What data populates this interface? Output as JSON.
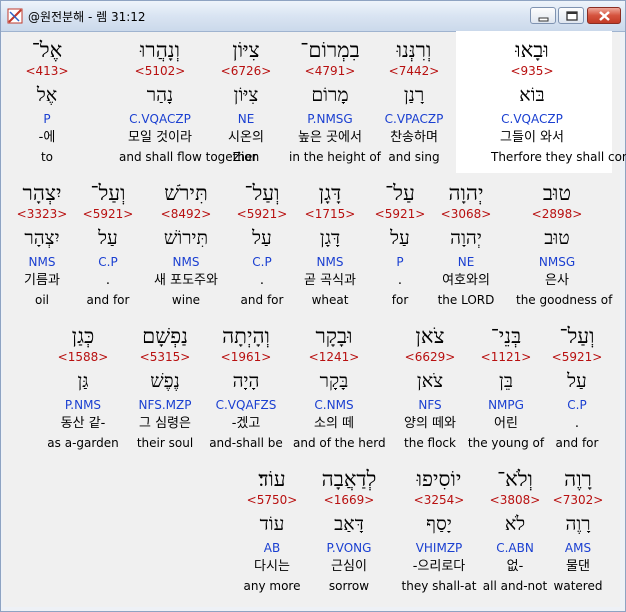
{
  "window": {
    "title": "@원전분해 - 렘 31:12"
  },
  "rows": [
    [
      {
        "heb": "וּבָאוּ",
        "strong": "<935>",
        "root": "בּוֹא",
        "morph": "C.VQACZP",
        "kor": "그들이 와서",
        "eng": "Therfore they shall come",
        "selected": true
      },
      {
        "heb": "וְרִנְּנוּ",
        "strong": "<7442>",
        "root": "רָנַן",
        "morph": "C.VPACZP",
        "kor": "찬송하며",
        "eng": "and sing"
      },
      {
        "heb": "בִמְרוֹם־",
        "strong": "<4791>",
        "root": "מָרוֹם",
        "morph": "P.NMSG",
        "kor": "높은 곳에서",
        "eng": "in the height of"
      },
      {
        "heb": "צִיּוֹן",
        "strong": "<6726>",
        "root": "צִיּוֹן",
        "morph": "NE",
        "kor": "시온의",
        "eng": "Zion"
      },
      {
        "heb": "וְנָהֲרוּ",
        "strong": "<5102>",
        "root": "נָהַר",
        "morph": "C.VQACZP",
        "kor": "모일 것이라",
        "eng": "and shall flow together"
      },
      {
        "heb": "אֶל־",
        "strong": "<413>",
        "root": "אֶל",
        "morph": "P",
        "kor": "-에",
        "eng": "to"
      }
    ],
    [
      {
        "heb": "טוּב",
        "strong": "<2898>",
        "root": "טוּב",
        "morph": "NMSG",
        "kor": "은사",
        "eng": "the goodness of"
      },
      {
        "heb": "יְהוָה",
        "strong": "<3068>",
        "root": "יְהוָה",
        "morph": "NE",
        "kor": "여호와의",
        "eng": "the LORD"
      },
      {
        "heb": "עַל־",
        "strong": "<5921>",
        "root": "עַל",
        "morph": "P",
        "kor": ".",
        "eng": "for"
      },
      {
        "heb": "דָּגָן",
        "strong": "<1715>",
        "root": "דָּגָן",
        "morph": "NMS",
        "kor": "곧 곡식과",
        "eng": "wheat"
      },
      {
        "heb": "וְעַל־",
        "strong": "<5921>",
        "root": "עַל",
        "morph": "C.P",
        "kor": ".",
        "eng": "and for"
      },
      {
        "heb": "תִּירֹשׁ",
        "strong": "<8492>",
        "root": "תִּירוֹשׁ",
        "morph": "NMS",
        "kor": "새 포도주와",
        "eng": "wine"
      },
      {
        "heb": "וְעַל־",
        "strong": "<5921>",
        "root": "עַל",
        "morph": "C.P",
        "kor": ".",
        "eng": "and for"
      },
      {
        "heb": "יִצְהָר",
        "strong": "<3323>",
        "root": "יִצְהָר",
        "morph": "NMS",
        "kor": "기름과",
        "eng": "oil"
      }
    ],
    [
      {
        "heb": "וְעַל־",
        "strong": "<5921>",
        "root": "עַל",
        "morph": "C.P",
        "kor": ".",
        "eng": "and for"
      },
      {
        "heb": "בְּנֵי־",
        "strong": "<1121>",
        "root": "בֵּן",
        "morph": "NMPG",
        "kor": "어린",
        "eng": "the young of"
      },
      {
        "heb": "צֹאן",
        "strong": "<6629>",
        "root": "צֹאן",
        "morph": "NFS",
        "kor": "양의 떼와",
        "eng": "the flock"
      },
      {
        "heb": "וּבָקָר",
        "strong": "<1241>",
        "root": "בָּקָר",
        "morph": "C.NMS",
        "kor": "소의 떼",
        "eng": "and of the herd"
      },
      {
        "heb": "וְהָיְתָה",
        "strong": "<1961>",
        "root": "הָיָה",
        "morph": "C.VQAFZS",
        "kor": "-겠고",
        "eng": "and-shall be"
      },
      {
        "heb": "נַפְשָׁם",
        "strong": "<5315>",
        "root": "נֶפֶשׁ",
        "morph": "NFS.MZP",
        "kor": "그 심령은",
        "eng": "their soul"
      },
      {
        "heb": "כְּגַן",
        "strong": "<1588>",
        "root": "גַּן",
        "morph": "P.NMS",
        "kor": "동산 같-",
        "eng": "as a-garden"
      }
    ],
    [
      {
        "heb": "רָוֶה",
        "strong": "<7302>",
        "root": "רָוֶה",
        "morph": "AMS",
        "kor": "물댄",
        "eng": "watered"
      },
      {
        "heb": "וְלֹא־",
        "strong": "<3808>",
        "root": "לֹא",
        "morph": "C.ABN",
        "kor": "없-",
        "eng": "all and-not"
      },
      {
        "heb": "יוֹסִיפוּ",
        "strong": "<3254>",
        "root": "יָסַף",
        "morph": "VHIMZP",
        "kor": "-으리로다",
        "eng": "they shall-at"
      },
      {
        "heb": "לְדַאֲבָה",
        "strong": "<1669>",
        "root": "דָּאַב",
        "morph": "P.VONG",
        "kor": "근심이",
        "eng": "sorrow"
      },
      {
        "heb": "עוֹד׃",
        "strong": "<5750>",
        "root": "עוֹד",
        "morph": "AB",
        "kor": "다시는",
        "eng": "any more"
      }
    ]
  ]
}
